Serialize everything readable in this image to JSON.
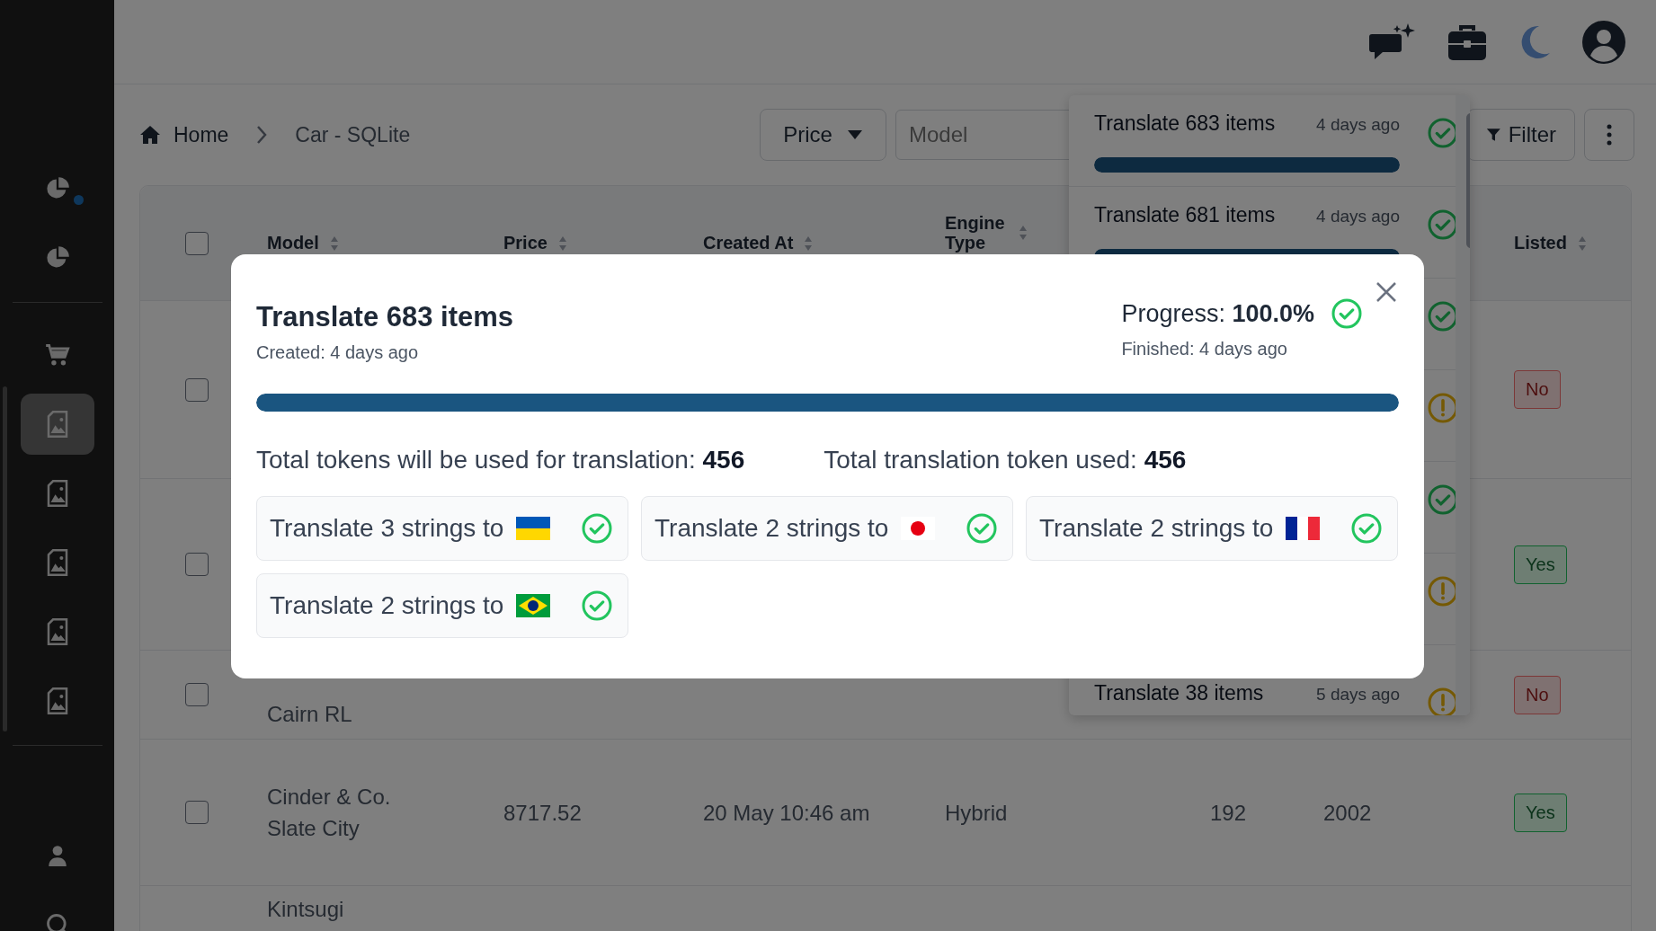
{
  "sidebar": {
    "items": [
      {
        "kind": "chart",
        "selected": false,
        "notification": true
      },
      {
        "kind": "chart",
        "selected": false,
        "notification": false
      },
      {
        "kind": "cart",
        "selected": false,
        "notification": false
      },
      {
        "kind": "image",
        "selected": true,
        "notification": false
      },
      {
        "kind": "image",
        "selected": false,
        "notification": false
      },
      {
        "kind": "image",
        "selected": false,
        "notification": false
      },
      {
        "kind": "image",
        "selected": false,
        "notification": false
      },
      {
        "kind": "image",
        "selected": false,
        "notification": false
      },
      {
        "kind": "user",
        "selected": false,
        "notification": false
      },
      {
        "kind": "search",
        "selected": false,
        "notification": false
      }
    ]
  },
  "breadcrumb": [
    {
      "label": "Home"
    },
    {
      "label": "Car - SQLite"
    }
  ],
  "toolbar": {
    "sort_button": "Price",
    "search": {
      "placeholder": "Model"
    },
    "filter_button": "Filter"
  },
  "table": {
    "header_checked": false,
    "columns": {
      "model": "Model",
      "price": "Price",
      "created_at": "Created At",
      "engine_type": "Engine Type",
      "listed": "Listed"
    },
    "rows": [
      {
        "checked": false,
        "listed": {
          "text": "No",
          "on": false
        }
      },
      {
        "checked": false,
        "listed": {
          "text": "Yes",
          "on": true
        }
      },
      {
        "checked": false,
        "model": "Cairn RL",
        "listed": {
          "text": "No",
          "on": false
        }
      },
      {
        "checked": false,
        "model": "Cinder & Co. Slate City",
        "price": "8717.52",
        "created_at": "20 May 10:46 am",
        "engine_type": "Hybrid",
        "column_5": "192",
        "column_6": "2002",
        "listed": {
          "text": "Yes",
          "on": true
        }
      },
      {
        "model": "Kintsugi"
      }
    ]
  },
  "tasks_panel": {
    "items": [
      {
        "title": "Translate 683 items",
        "time": "4 days ago",
        "done": true,
        "level": 1
      },
      {
        "title": "Translate 681 items",
        "time": "4 days ago",
        "done": true,
        "level": 1
      },
      {
        "done": true
      },
      {
        "done": false
      },
      {
        "done": true
      },
      {
        "done": false
      },
      {
        "title": "Translate 38 items",
        "time": "5 days ago",
        "done": false
      }
    ]
  },
  "modal": {
    "title": "Translate 683 items",
    "created": "Created: 4 days ago",
    "progress": "Progress: **100.0%**",
    "done": true,
    "finished": "Finished: 4 days ago",
    "level": 1,
    "tokens_estimated": "Total tokens will be used for translation: **456**",
    "tokens_used": "Total translation token used: **456**",
    "tasks": [
      {
        "label": "Translate 3 strings to",
        "kind": "ukraine",
        "done": true
      },
      {
        "label": "Translate 2 strings to",
        "kind": "japan",
        "done": true
      },
      {
        "label": "Translate 2 strings to",
        "kind": "france",
        "done": true
      },
      {
        "label": "Translate 2 strings to",
        "kind": "brazil",
        "done": true
      }
    ]
  }
}
